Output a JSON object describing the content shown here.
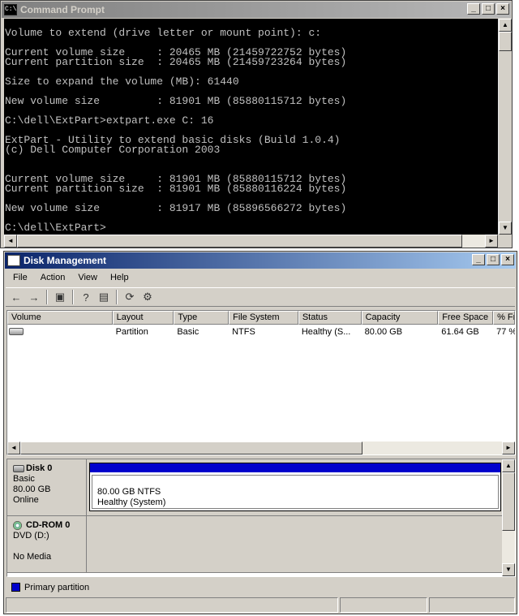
{
  "cmd": {
    "title": "Command Prompt",
    "icon": "C:\\",
    "lines": [
      "Volume to extend (drive letter or mount point): c:",
      "",
      "Current volume size     : 20465 MB (21459722752 bytes)",
      "Current partition size  : 20465 MB (21459723264 bytes)",
      "",
      "Size to expand the volume (MB): 61440",
      "",
      "New volume size         : 81901 MB (85880115712 bytes)",
      "",
      "C:\\dell\\ExtPart>extpart.exe C: 16",
      "",
      "ExtPart - Utility to extend basic disks (Build 1.0.4)",
      "(c) Dell Computer Corporation 2003",
      "",
      "",
      "Current volume size     : 81901 MB (85880115712 bytes)",
      "Current partition size  : 81901 MB (85880116224 bytes)",
      "",
      "New volume size         : 81917 MB (85896566272 bytes)",
      "",
      "C:\\dell\\ExtPart>"
    ]
  },
  "dm": {
    "title": "Disk Management",
    "menu": [
      "File",
      "Action",
      "View",
      "Help"
    ],
    "columns": [
      "Volume",
      "Layout",
      "Type",
      "File System",
      "Status",
      "Capacity",
      "Free Space",
      "% Fr"
    ],
    "rows": [
      {
        "volume": "",
        "layout": "Partition",
        "type": "Basic",
        "fs": "NTFS",
        "status": "Healthy (S...",
        "capacity": "80.00 GB",
        "free": "61.64 GB",
        "pct": "77 %"
      }
    ],
    "disks": [
      {
        "name": "Disk 0",
        "type": "Basic",
        "size": "80.00 GB",
        "state": "Online",
        "partition_label": "80.00 GB NTFS",
        "partition_status": "Healthy (System)"
      },
      {
        "name": "CD-ROM 0",
        "type": "DVD (D:)",
        "size": "",
        "state": "No Media"
      }
    ],
    "legend": "Primary partition",
    "colors": {
      "primary_partition": "#0000cc",
      "title_active": "#0a246a"
    }
  }
}
